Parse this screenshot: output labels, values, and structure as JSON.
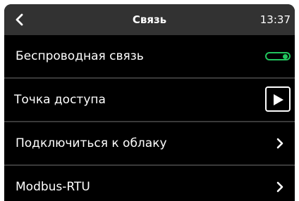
{
  "header": {
    "title": "Связь",
    "time": "13:37",
    "back_icon": "chevron-left-icon"
  },
  "rows": [
    {
      "label": "Беспроводная связь",
      "control": "toggle",
      "toggle_on": true
    },
    {
      "label": "Точка доступа",
      "control": "play-button",
      "icon": "play-icon"
    },
    {
      "label": "Подключиться к облаку",
      "control": "chevron",
      "icon": "chevron-right-icon"
    },
    {
      "label": "Modbus-RTU",
      "control": "chevron",
      "icon": "chevron-right-icon"
    }
  ],
  "colors": {
    "header_bg": "#323232",
    "screen_bg": "#000000",
    "accent": "#22c55e",
    "text": "#ffffff"
  }
}
